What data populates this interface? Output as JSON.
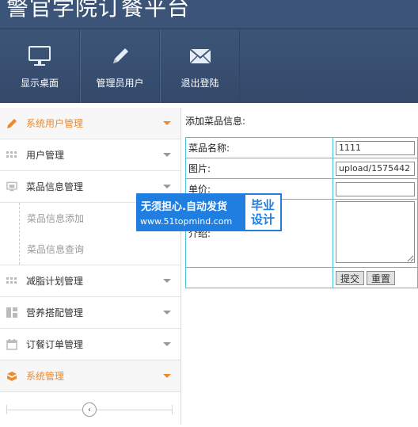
{
  "app": {
    "title": "警官学院订餐平台"
  },
  "topnav": [
    {
      "label": "显示桌面",
      "icon": "monitor-icon"
    },
    {
      "label": "管理员用户",
      "icon": "pencil-icon"
    },
    {
      "label": "退出登陆",
      "icon": "envelope-icon"
    }
  ],
  "sidebar": {
    "items": [
      {
        "label": "系统用户管理",
        "icon": "pencil-icon",
        "active": true
      },
      {
        "label": "用户管理",
        "icon": "grid-icon"
      },
      {
        "label": "菜品信息管理",
        "icon": "screen-icon"
      },
      {
        "label": "减脂计划管理",
        "icon": "grid-icon"
      },
      {
        "label": "营养搭配管理",
        "icon": "layout-icon"
      },
      {
        "label": "订餐订单管理",
        "icon": "calendar-icon"
      },
      {
        "label": "系统管理",
        "icon": "box-icon",
        "active": true
      }
    ],
    "subitems": [
      {
        "label": "菜品信息添加"
      },
      {
        "label": "菜品信息查询"
      }
    ],
    "collapse_symbol": "‹"
  },
  "main": {
    "title": "添加菜品信息:",
    "form": {
      "name_label": "菜品名称:",
      "name_value": "1111",
      "image_label": "图片:",
      "image_value": "upload/1575442",
      "price_label": "单价:",
      "price_value": "",
      "intro_label": "介绍:",
      "submit_label": "提交",
      "reset_label": "重置"
    }
  },
  "ad": {
    "line1": "无须担心.自动发货",
    "line2": "www.51topmind.com",
    "side_top": "毕业",
    "side_bottom": "设计"
  },
  "colors": {
    "accent": "#ef8a2b",
    "header": "#3b5478",
    "table_border": "#42c6dc",
    "ad_blue": "#1f7ee0"
  }
}
